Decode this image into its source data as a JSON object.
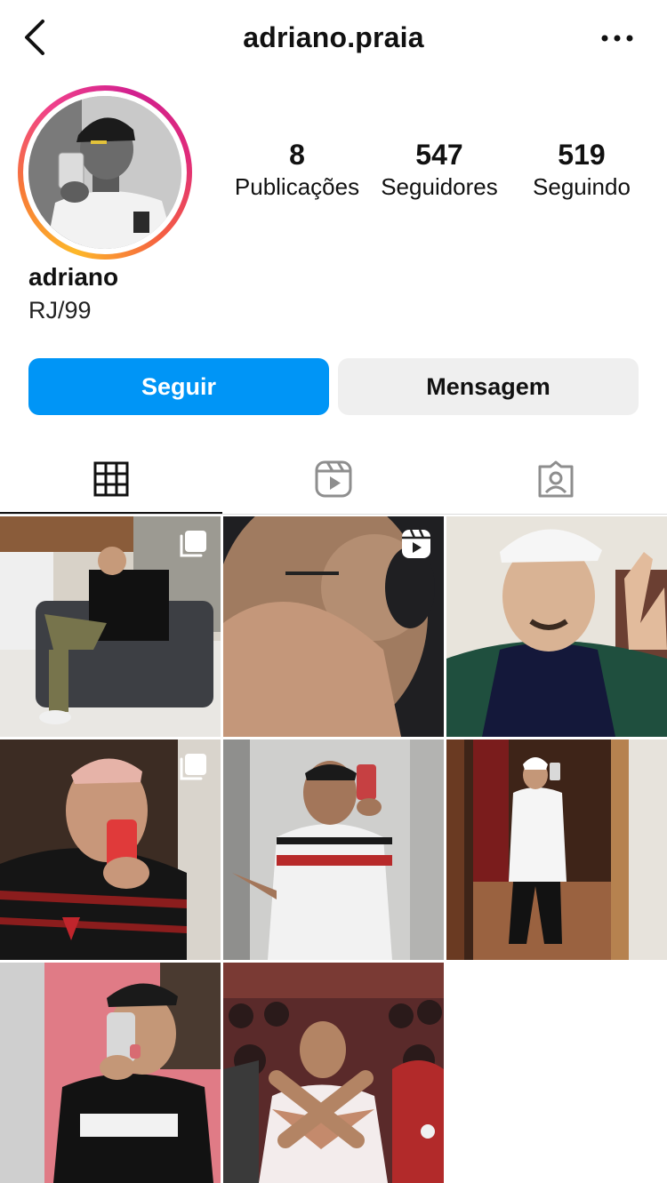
{
  "header": {
    "username": "adriano.praia"
  },
  "profile": {
    "display_name": "adriano",
    "bio": "RJ/99",
    "stats": [
      {
        "value": "8",
        "label": "Publicações"
      },
      {
        "value": "547",
        "label": "Seguidores"
      },
      {
        "value": "519",
        "label": "Seguindo"
      }
    ]
  },
  "actions": {
    "follow_label": "Seguir",
    "message_label": "Mensagem"
  },
  "tabs": [
    {
      "icon": "grid-icon",
      "active": true
    },
    {
      "icon": "reels-icon",
      "active": false
    },
    {
      "icon": "tagged-icon",
      "active": false
    }
  ],
  "posts": [
    {
      "type": "carousel"
    },
    {
      "type": "reel"
    },
    {
      "type": "photo"
    },
    {
      "type": "carousel"
    },
    {
      "type": "photo"
    },
    {
      "type": "photo"
    },
    {
      "type": "photo"
    },
    {
      "type": "photo"
    }
  ],
  "colors": {
    "accent": "#0095f6",
    "secondary_button": "#efefef"
  }
}
